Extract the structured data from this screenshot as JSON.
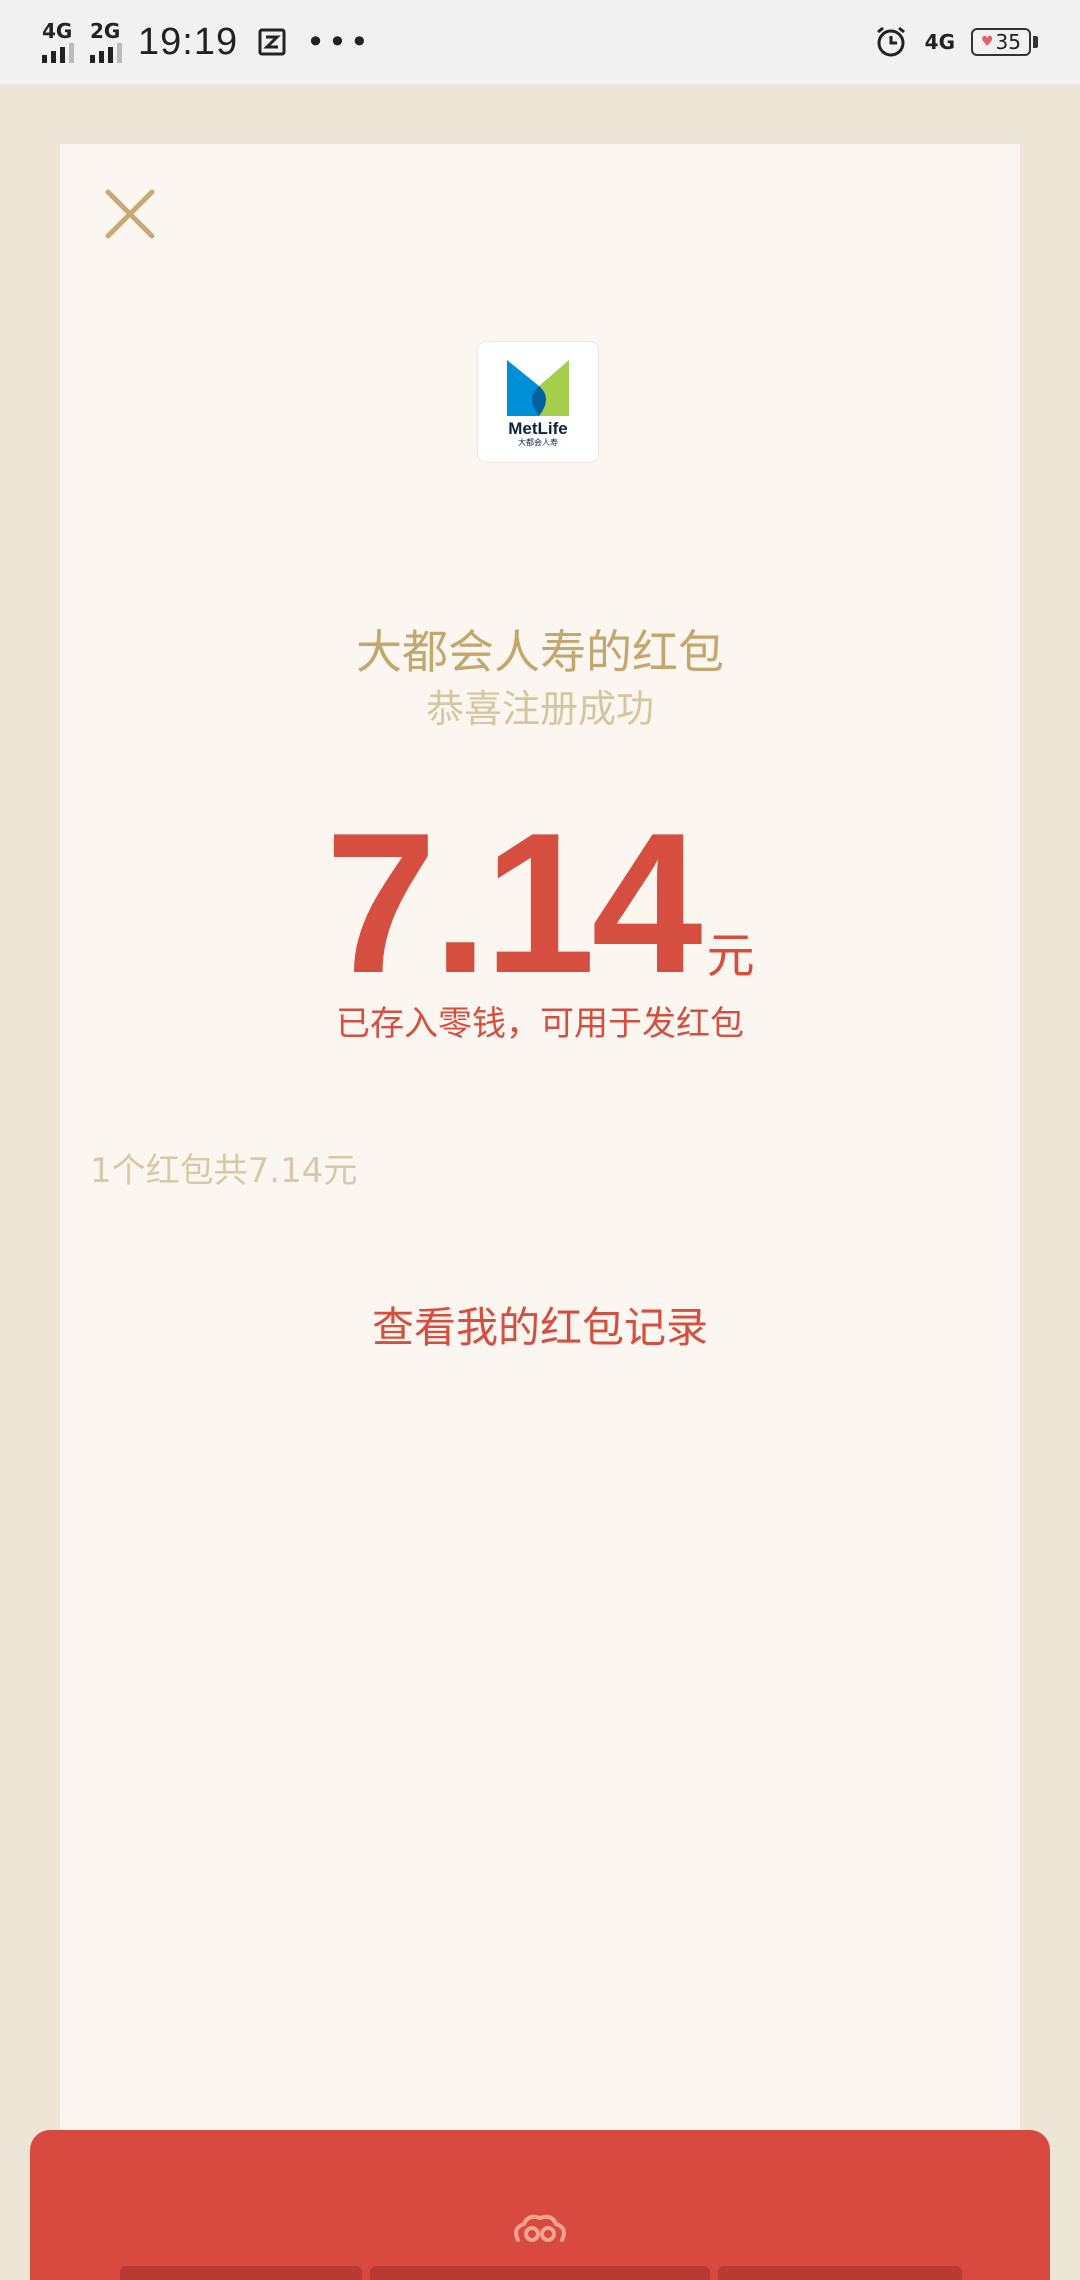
{
  "status_bar": {
    "net1": "4G",
    "net2": "2G",
    "time": "19:19",
    "dots": "•••",
    "net_right": "4G",
    "battery": "35"
  },
  "card": {
    "title": "大都会人寿的红包",
    "subtitle": "恭喜注册成功",
    "amount": "7.14",
    "unit": "元",
    "note": "已存入零钱，可用于发红包",
    "summary": "1个红包共7.14元",
    "record_link": "查看我的红包记录"
  },
  "logo": {
    "brand": "MetLife",
    "sub": "大都会人寿"
  },
  "colors": {
    "accent_red": "#d64e40",
    "gold": "#c4a66f",
    "card_bg": "#fbf6ef",
    "page_bg": "#ede5d5"
  },
  "icons": {
    "close": "close-icon",
    "logo": "metlife-logo",
    "cloud": "cloud-pattern-icon",
    "alarm": "alarm-icon",
    "sim": "sim-icon"
  }
}
